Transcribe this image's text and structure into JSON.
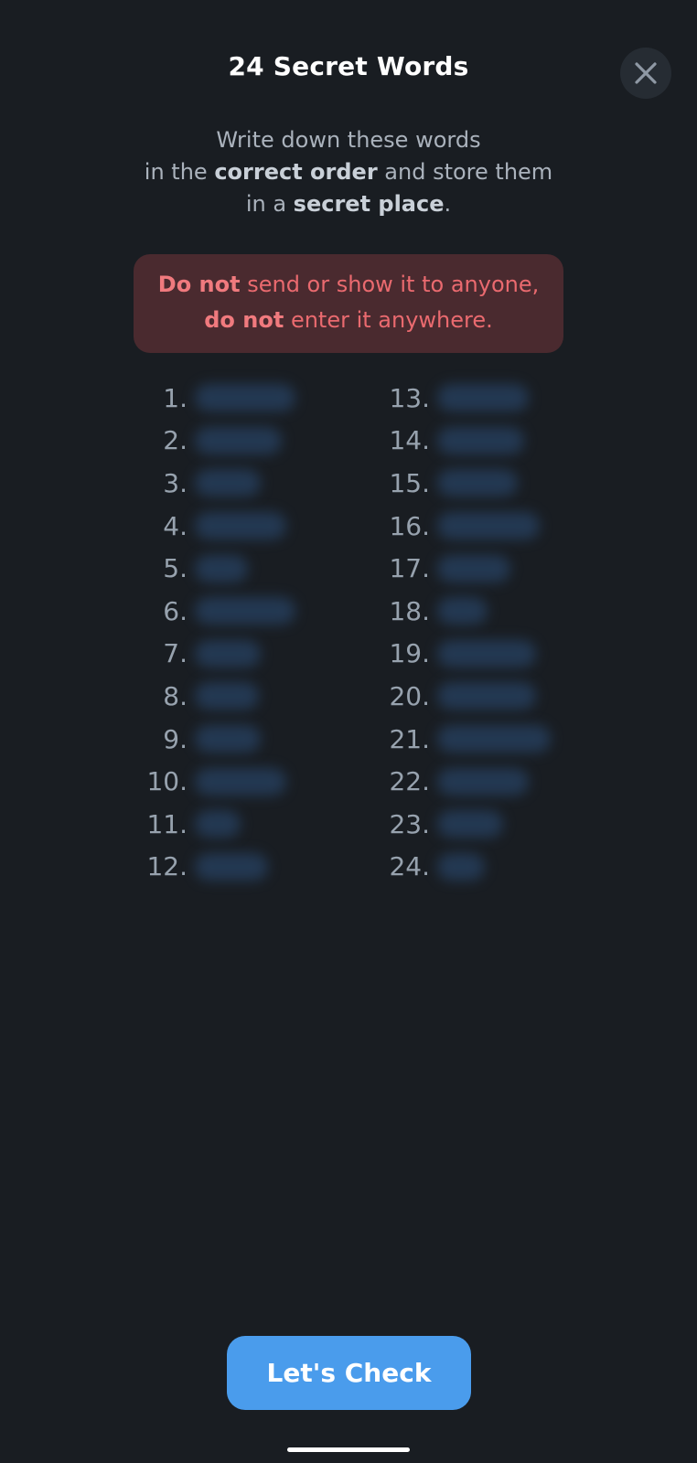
{
  "header": {
    "title": "24 Secret Words"
  },
  "instructions": {
    "line1": "Write down these words",
    "line2_pre": "in the ",
    "line2_bold": "correct order",
    "line2_post": " and store them",
    "line3_pre": "in a ",
    "line3_bold": "secret place",
    "line3_post": "."
  },
  "warning": {
    "line1_bold": "Do not",
    "line1_rest": " send or show it to anyone,",
    "line2_bold": "do not",
    "line2_rest": " enter it anywhere."
  },
  "words_left": [
    {
      "num": "1."
    },
    {
      "num": "2."
    },
    {
      "num": "3."
    },
    {
      "num": "4."
    },
    {
      "num": "5."
    },
    {
      "num": "6."
    },
    {
      "num": "7."
    },
    {
      "num": "8."
    },
    {
      "num": "9."
    },
    {
      "num": "10."
    },
    {
      "num": "11."
    },
    {
      "num": "12."
    }
  ],
  "words_right": [
    {
      "num": "13."
    },
    {
      "num": "14."
    },
    {
      "num": "15."
    },
    {
      "num": "16."
    },
    {
      "num": "17."
    },
    {
      "num": "18."
    },
    {
      "num": "19."
    },
    {
      "num": "20."
    },
    {
      "num": "21."
    },
    {
      "num": "22."
    },
    {
      "num": "23."
    },
    {
      "num": "24."
    }
  ],
  "footer": {
    "check_label": "Let's Check"
  },
  "colors": {
    "background": "#191d22",
    "accent": "#4a9cec",
    "warning_bg": "#4a2a2f",
    "warning_text": "#ea6a6f"
  },
  "icons": {
    "close": "close-icon"
  }
}
